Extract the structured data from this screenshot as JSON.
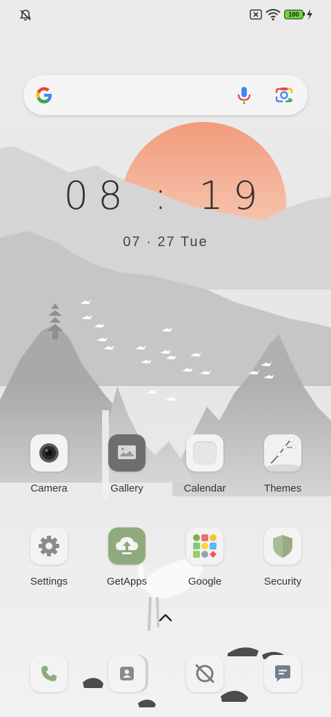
{
  "status": {
    "icons": [
      "notifications-off-icon",
      "sim-disabled-icon",
      "wifi-icon",
      "battery-icon",
      "charging-icon"
    ],
    "battery": "100"
  },
  "search": {
    "logo": "google-logo-icon",
    "mic": "microphone-icon",
    "lens": "camera-lens-icon"
  },
  "clock": {
    "time": "08 : 19",
    "date": "07 · 27 Tue"
  },
  "apps": [
    {
      "label": "Camera",
      "icon": "camera-icon"
    },
    {
      "label": "Gallery",
      "icon": "gallery-icon"
    },
    {
      "label": "Calendar",
      "icon": "calendar-icon"
    },
    {
      "label": "Themes",
      "icon": "themes-icon"
    },
    {
      "label": "Settings",
      "icon": "gear-icon"
    },
    {
      "label": "GetApps",
      "icon": "getapps-icon"
    },
    {
      "label": "Google",
      "icon": "google-folder-icon"
    },
    {
      "label": "Security",
      "icon": "shield-icon"
    }
  ],
  "dock": [
    {
      "icon": "phone-icon"
    },
    {
      "icon": "contacts-icon"
    },
    {
      "icon": "browser-icon"
    },
    {
      "icon": "messages-icon"
    }
  ],
  "colors": {
    "sun": "#f4a07f",
    "getapps": "#8faa7d",
    "security": "#97ab85",
    "text": "#333333"
  }
}
